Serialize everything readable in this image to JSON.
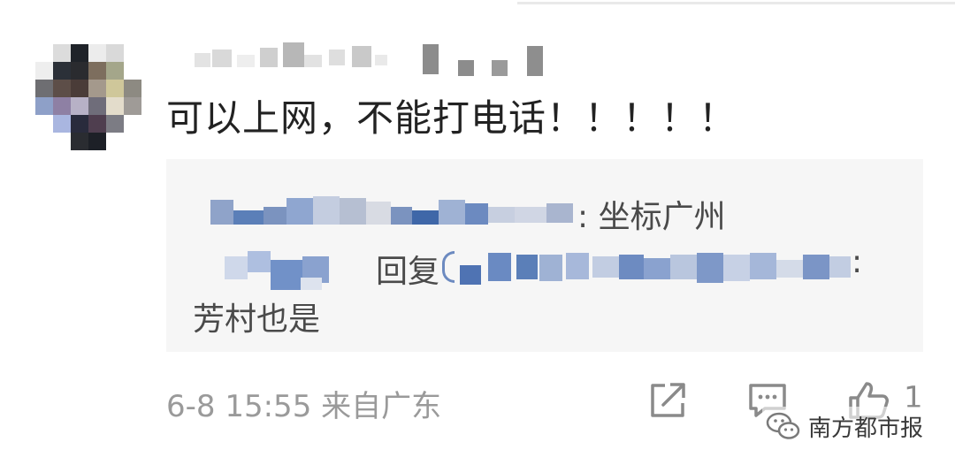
{
  "comment": {
    "text": "可以上网，不能打电话！！！！！",
    "meta": "6-8 15:55 来自广东",
    "like_count": "1"
  },
  "reply": {
    "line1_suffix": ": 坐标广州",
    "line2_label": "回复",
    "line2_colon": ":",
    "line3_text": "芳村也是"
  },
  "watermark": {
    "label": "南方都市报"
  },
  "icons": {
    "share": "share-icon",
    "comment": "comment-icon",
    "like": "thumbs-up-icon",
    "watermark": "wechat-icon"
  },
  "colors": {
    "text_primary": "#222222",
    "text_secondary": "#4a4a4a",
    "meta_gray": "#9a9a9a",
    "reply_bg": "#f6f6f6",
    "blur_blue": "#5b7fb8"
  }
}
